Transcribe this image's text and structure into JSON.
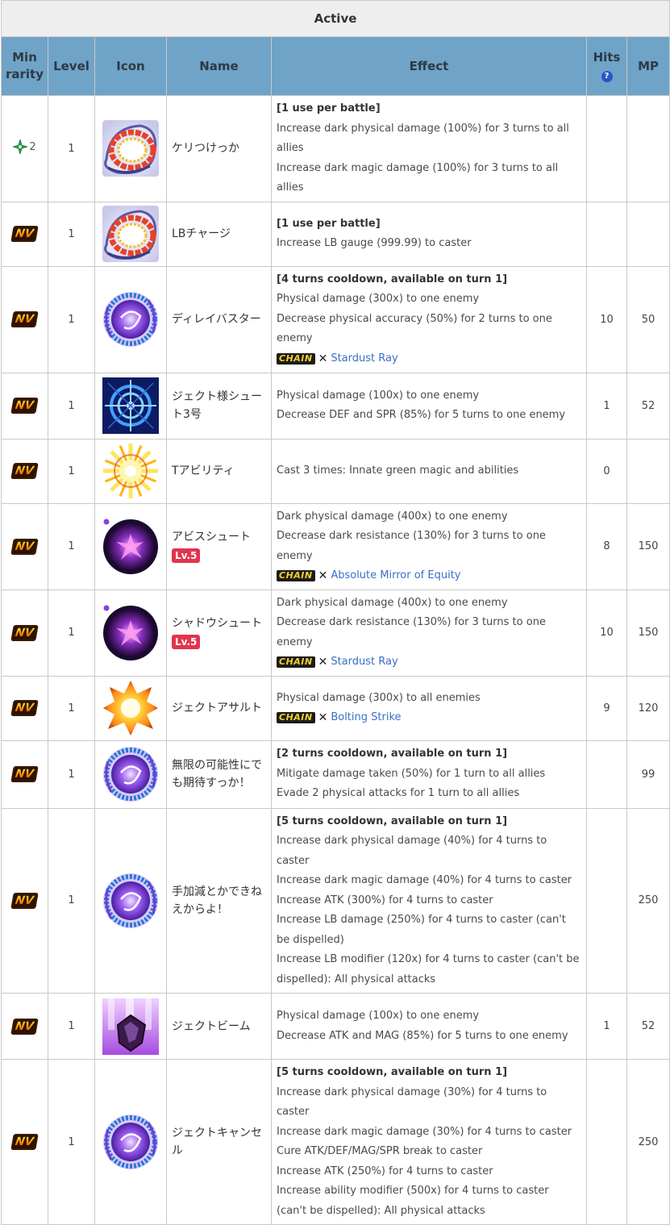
{
  "title": "Active",
  "headers": {
    "min_rarity": "Min rarity",
    "level": "Level",
    "icon": "Icon",
    "name": "Name",
    "effect": "Effect",
    "hits": "Hits",
    "hits_help": "?",
    "mp": "MP"
  },
  "badges": {
    "nv": "NV",
    "chain": "CHAIN",
    "chain_x": "✕"
  },
  "rows": [
    {
      "rarity": "2",
      "rarity_type": "star",
      "level": "1",
      "icon": "swirl-red-icon",
      "name": "ケリつけっか",
      "lv": "",
      "effect": [
        "[1 use per battle]",
        "Increase dark physical damage (100%) for 3 turns to all allies",
        "Increase dark magic damage (100%) for 3 turns to all allies"
      ],
      "chain": "",
      "hits": "",
      "mp": ""
    },
    {
      "rarity": "NV",
      "rarity_type": "nv",
      "level": "1",
      "icon": "swirl-red-icon",
      "name": "LBチャージ",
      "lv": "",
      "effect": [
        "[1 use per battle]",
        "Increase LB gauge (999.99) to caster"
      ],
      "chain": "",
      "hits": "",
      "mp": ""
    },
    {
      "rarity": "NV",
      "rarity_type": "nv",
      "level": "1",
      "icon": "swirl-purple-icon",
      "name": "ディレイバスター",
      "lv": "",
      "effect": [
        "[4 turns cooldown, available on turn 1]",
        "Physical damage (300x) to one enemy",
        "Decrease physical accuracy (50%) for 2 turns to one enemy"
      ],
      "chain": "Stardust Ray",
      "hits": "10",
      "mp": "50"
    },
    {
      "rarity": "NV",
      "rarity_type": "nv",
      "level": "1",
      "icon": "crosshair-icon",
      "name": "ジェクト様シュート3号",
      "lv": "",
      "effect": [
        "Physical damage (100x) to one enemy",
        "Decrease DEF and SPR (85%) for 5 turns to one enemy"
      ],
      "chain": "",
      "hits": "1",
      "mp": "52"
    },
    {
      "rarity": "NV",
      "rarity_type": "nv",
      "level": "1",
      "icon": "burst-yellow-icon",
      "name": "Tアビリティ",
      "lv": "",
      "effect": [
        "Cast 3 times: Innate green magic and abilities"
      ],
      "chain": "",
      "hits": "0",
      "mp": ""
    },
    {
      "rarity": "NV",
      "rarity_type": "nv",
      "level": "1",
      "icon": "dark-orb-icon",
      "name": "アビスシュート",
      "lv": "Lv.5",
      "effect": [
        "Dark physical damage (400x) to one enemy",
        "Decrease dark resistance (130%) for 3 turns to one enemy"
      ],
      "chain": "Absolute Mirror of Equity",
      "hits": "8",
      "mp": "150"
    },
    {
      "rarity": "NV",
      "rarity_type": "nv",
      "level": "1",
      "icon": "dark-orb-icon",
      "name": "シャドウシュート",
      "lv": "Lv.5",
      "effect": [
        "Dark physical damage (400x) to one enemy",
        "Decrease dark resistance (130%) for 3 turns to one enemy"
      ],
      "chain": "Stardust Ray",
      "hits": "10",
      "mp": "150"
    },
    {
      "rarity": "NV",
      "rarity_type": "nv",
      "level": "1",
      "icon": "explosion-icon",
      "name": "ジェクトアサルト",
      "lv": "",
      "effect": [
        "Physical damage (300x) to all enemies"
      ],
      "chain": "Bolting Strike",
      "hits": "9",
      "mp": "120"
    },
    {
      "rarity": "NV",
      "rarity_type": "nv",
      "level": "1",
      "icon": "swirl-purple-icon",
      "name": "無限の可能性にでも期待すっか！",
      "lv": "",
      "effect": [
        "[2 turns cooldown, available on turn 1]",
        "Mitigate damage taken (50%) for 1 turn to all allies",
        "Evade 2 physical attacks for 1 turn to all allies"
      ],
      "chain": "",
      "hits": "",
      "mp": "99"
    },
    {
      "rarity": "NV",
      "rarity_type": "nv",
      "level": "1",
      "icon": "swirl-purple-icon",
      "name": "手加減とかできねえからよ！",
      "lv": "",
      "effect": [
        "[5 turns cooldown, available on turn 1]",
        "Increase dark physical damage (40%) for 4 turns to caster",
        "Increase dark magic damage (40%) for 4 turns to caster",
        "Increase ATK (300%) for 4 turns to caster",
        "Increase LB damage (250%) for 4 turns to caster (can't be dispelled)",
        "Increase LB modifier (120x) for 4 turns to caster (can't be dispelled): All physical attacks"
      ],
      "chain": "",
      "hits": "",
      "mp": "250"
    },
    {
      "rarity": "NV",
      "rarity_type": "nv",
      "level": "1",
      "icon": "crystal-beam-icon",
      "name": "ジェクトビーム",
      "lv": "",
      "effect": [
        "Physical damage (100x) to one enemy",
        "Decrease ATK and MAG (85%) for 5 turns to one enemy"
      ],
      "chain": "",
      "hits": "1",
      "mp": "52"
    },
    {
      "rarity": "NV",
      "rarity_type": "nv",
      "level": "1",
      "icon": "swirl-purple-icon",
      "name": "ジェクトキャンセル",
      "lv": "",
      "effect": [
        "[5 turns cooldown, available on turn 1]",
        "Increase dark physical damage (30%) for 4 turns to caster",
        "Increase dark magic damage (30%) for 4 turns to caster",
        "Cure ATK/DEF/MAG/SPR break to caster",
        "Increase ATK (250%) for 4 turns to caster",
        "Increase ability modifier (500x) for 4 turns to caster (can't be dispelled): All physical attacks"
      ],
      "chain": "",
      "hits": "",
      "mp": "250"
    }
  ]
}
